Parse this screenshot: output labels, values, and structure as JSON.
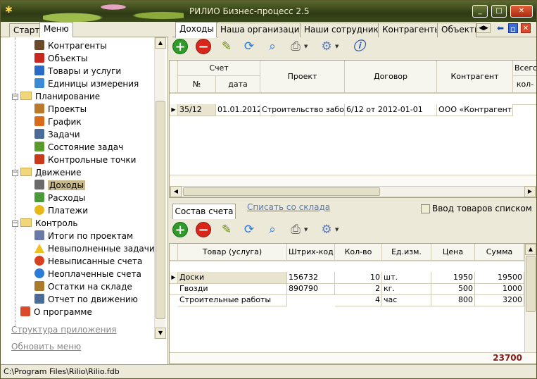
{
  "window": {
    "title": "РИЛИО Бизнес-процесс 2.5",
    "buttons": [
      "_",
      "□",
      "✕"
    ]
  },
  "left": {
    "tabs": [
      "Старт",
      "Меню"
    ],
    "tree": [
      {
        "label": "Контрагенты",
        "icon": "contacts-icon"
      },
      {
        "label": "Объекты",
        "icon": "house-icon"
      },
      {
        "label": "Товары и услуги",
        "icon": "goods-icon"
      },
      {
        "label": "Единицы измерения",
        "icon": "drop-icon"
      },
      {
        "label": "Планирование",
        "icon": "folder-icon"
      },
      {
        "label": "Проекты",
        "icon": "projects-icon"
      },
      {
        "label": "График",
        "icon": "chart-icon"
      },
      {
        "label": "Задачи",
        "icon": "stopwatch-icon"
      },
      {
        "label": "Состояние задач",
        "icon": "pencil-icon"
      },
      {
        "label": "Контрольные точки",
        "icon": "pin-icon"
      },
      {
        "label": "Движение",
        "icon": "folder-icon"
      },
      {
        "label": "Доходы",
        "icon": "ledger-icon"
      },
      {
        "label": "Расходы",
        "icon": "money-icon"
      },
      {
        "label": "Платежи",
        "icon": "coin-icon"
      },
      {
        "label": "Контроль",
        "icon": "folder-icon"
      },
      {
        "label": "Итоги по проектам",
        "icon": "database-icon"
      },
      {
        "label": "Невыполненные задачи",
        "icon": "warning-icon"
      },
      {
        "label": "Невыписанные счета",
        "icon": "red-circle-icon"
      },
      {
        "label": "Неоплаченные счета",
        "icon": "blue-circle-icon"
      },
      {
        "label": "Остатки на складе",
        "icon": "boxes-icon"
      },
      {
        "label": "Отчет по движению",
        "icon": "report-icon"
      },
      {
        "label": "О программе",
        "icon": "lifebuoy-icon"
      }
    ],
    "links": [
      "Структура приложения",
      "Обновить меню"
    ]
  },
  "right": {
    "tabs": [
      "Доходы",
      "Наша организация",
      "Наши сотрудники",
      "Контрагенты",
      "Объекты"
    ],
    "top_grid": {
      "group_header": "Счет",
      "headers": [
        "№",
        "дата",
        "Проект",
        "Договор",
        "Контрагент",
        "Всего",
        "кол-"
      ],
      "rows": [
        [
          "35/12",
          "01.01.2012",
          "Строительство забора",
          "6/12 от 2012-01-01",
          "ООО «Контрагент»",
          ""
        ]
      ]
    },
    "bottom_tabs": {
      "active": "Состав счета",
      "link": "Списать со склада",
      "checkbox_label": "Ввод товаров списком"
    },
    "bottom_grid": {
      "headers": [
        "Товар (услуга)",
        "Штрих-код",
        "Кол-во",
        "Ед.изм.",
        "Цена",
        "Сумма"
      ],
      "rows": [
        [
          "Доски",
          "156732",
          "10",
          "шт.",
          "1950",
          "19500"
        ],
        [
          "Гвозди",
          "890790",
          "2",
          "кг.",
          "500",
          "1000"
        ],
        [
          "Строительные работы",
          "",
          "4",
          "час",
          "800",
          "3200"
        ]
      ],
      "total": "23700"
    }
  },
  "status": {
    "path": "C:\\Program Files\\Rilio\\Rilio.fdb"
  },
  "colors": {
    "total": "#8b1a1a",
    "selected": "#c9b98a",
    "link": "#5a7ab8"
  }
}
